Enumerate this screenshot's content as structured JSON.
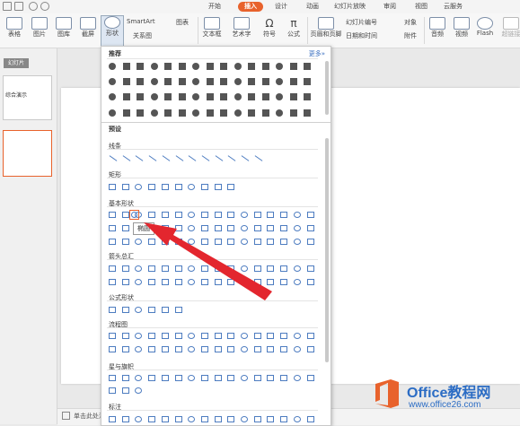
{
  "tabs": [
    "开始",
    "插入",
    "设计",
    "动画",
    "幻灯片放映",
    "审阅",
    "视图",
    "云服务"
  ],
  "active_tab": "插入",
  "ribbon": {
    "table": "表格",
    "picture": "图片",
    "gallery": "图库",
    "screenshot": "截屏",
    "shape": "形状",
    "smartart": "SmartArt",
    "chart": "图表",
    "relation": "关系图",
    "textbox": "文本框",
    "wordart": "艺术字",
    "symbol": "符号",
    "formula": "公式",
    "header_footer": "页眉和页脚",
    "slide_number": "幻灯片编号",
    "object": "对象",
    "datetime": "日期和时间",
    "attachment": "附件",
    "audio": "音频",
    "video": "视频",
    "flash": "Flash",
    "hyperlink": "超链接"
  },
  "left": {
    "tab_label": "幻灯片",
    "slide1_text": "综合演示"
  },
  "dropdown": {
    "recommend": "推荐",
    "more": "更多»",
    "preset": "预设",
    "lines": "线条",
    "rect": "矩形",
    "basic": "基本形状",
    "arrows": "箭头总汇",
    "formula": "公式形状",
    "flowchart": "流程图",
    "stars": "星与旗帜",
    "callouts": "标注"
  },
  "tooltip": "椭圆",
  "notes": "单击此处添加备注",
  "logo": {
    "title": "Office教程网",
    "url": "www.office26.com"
  },
  "colors": {
    "accent": "#e8622c",
    "shape_blue": "#4d7cc0",
    "arrow_red": "#e3262e"
  }
}
